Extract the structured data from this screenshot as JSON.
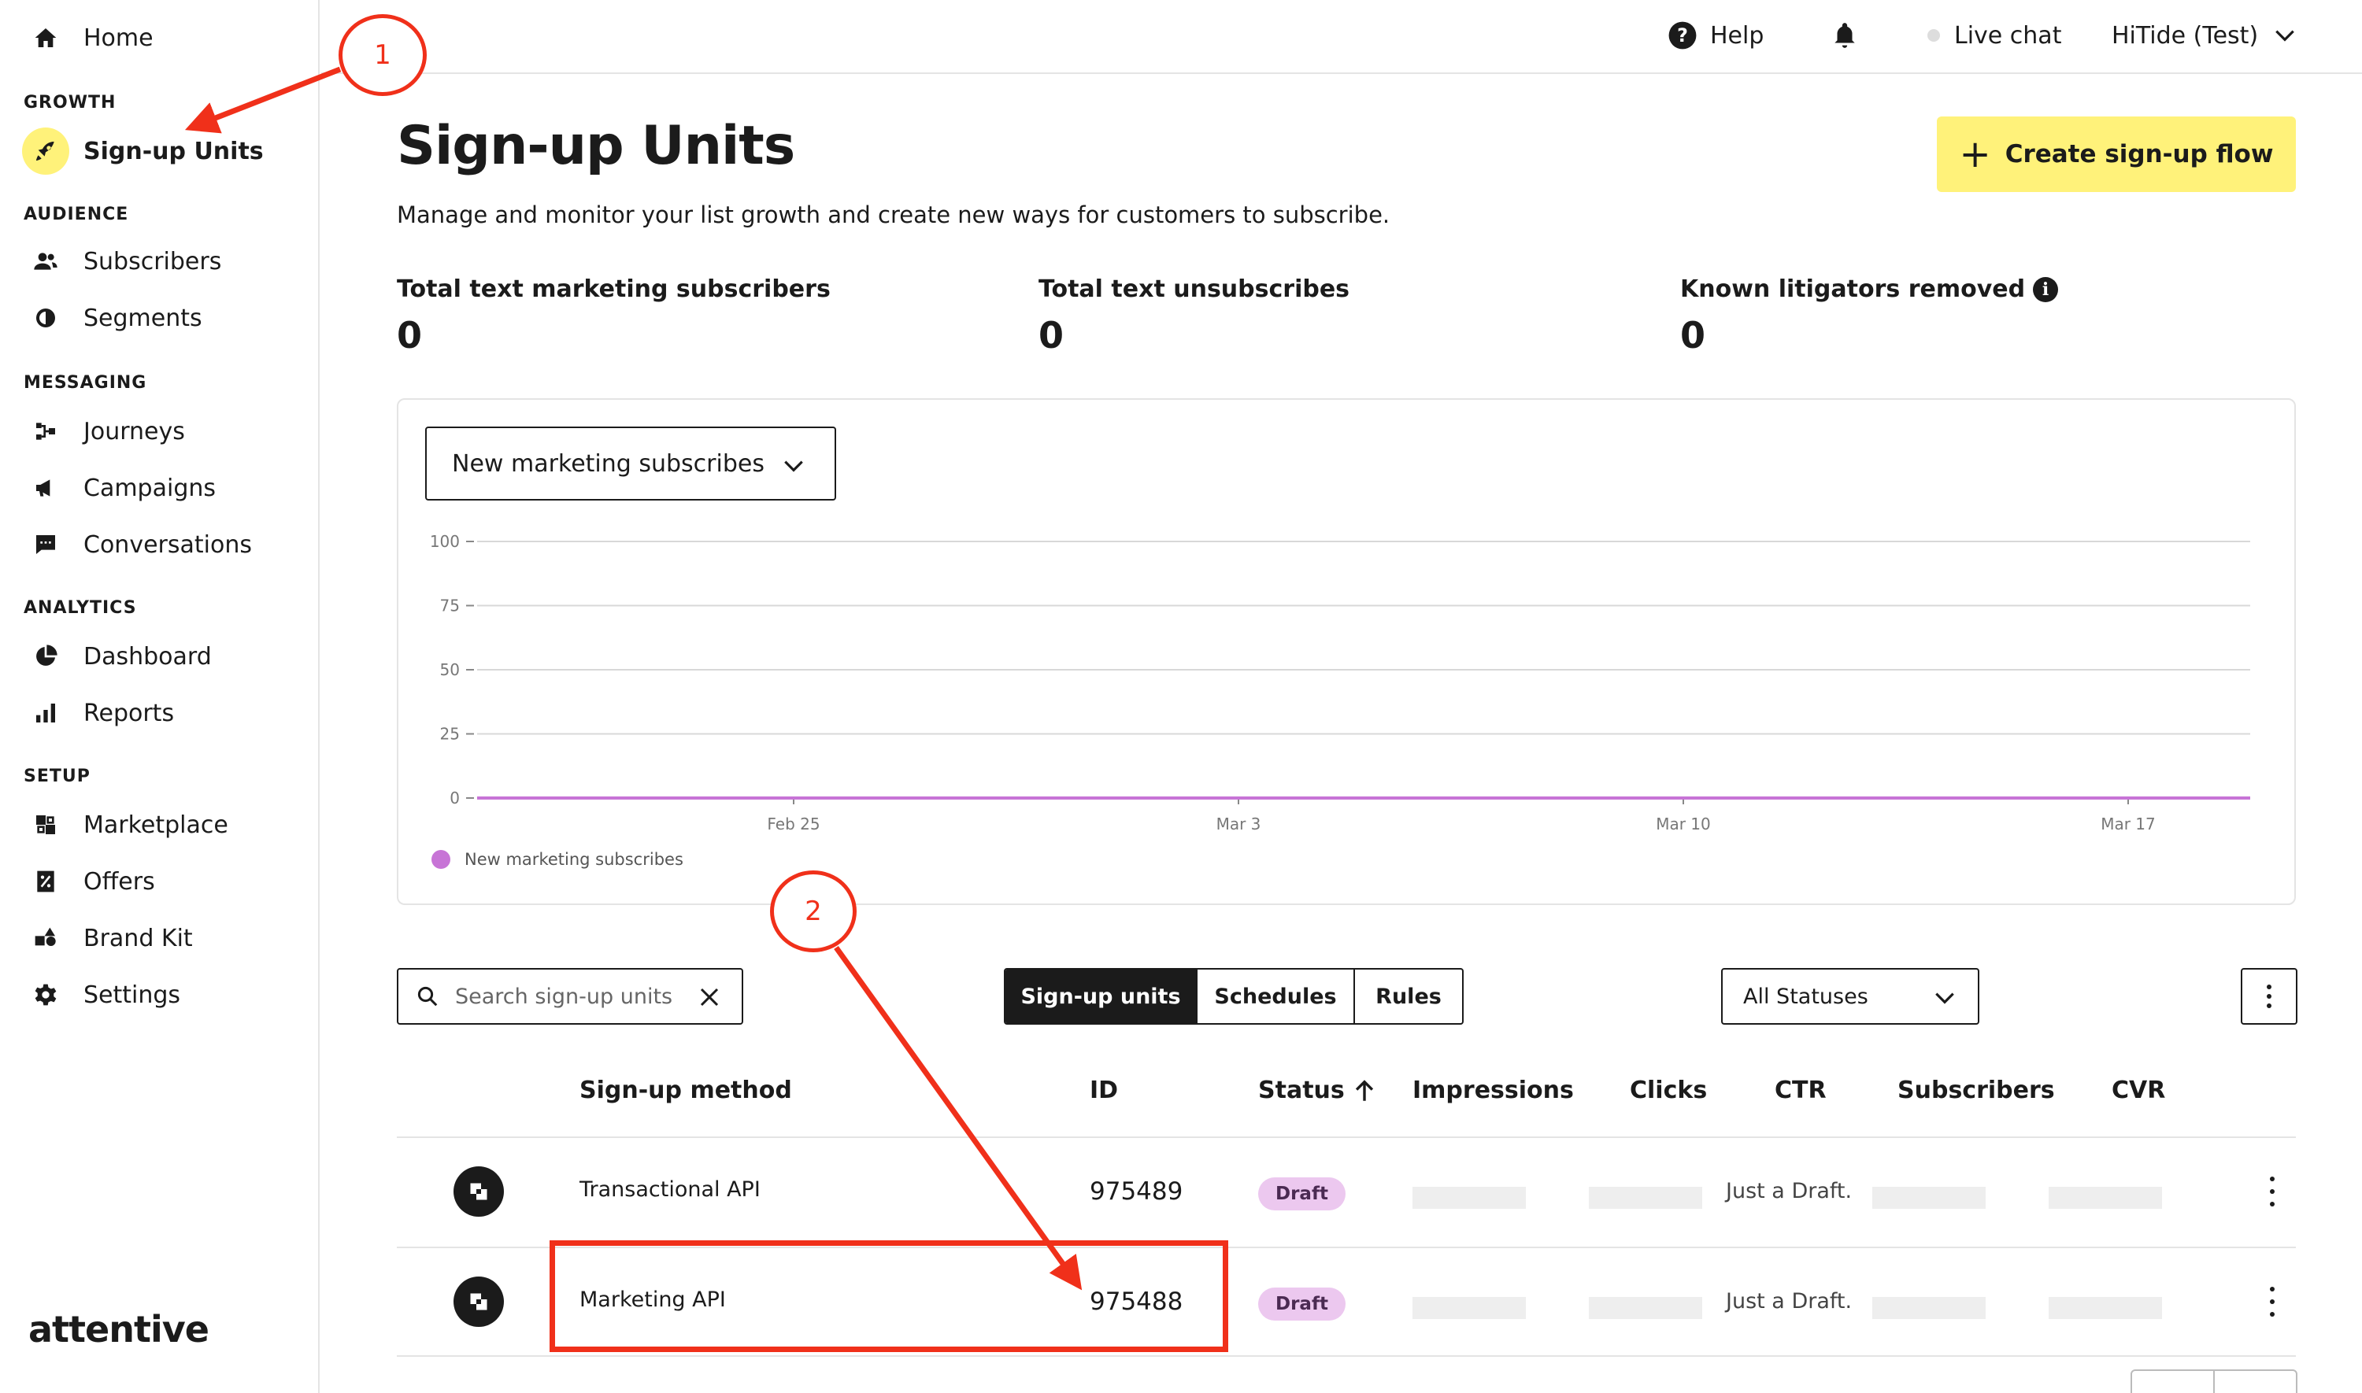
{
  "sidebar": {
    "home": "Home",
    "sections": {
      "growth": "GROWTH",
      "audience": "AUDIENCE",
      "messaging": "MESSAGING",
      "analytics": "ANALYTICS",
      "setup": "SETUP"
    },
    "items": {
      "signup_units": "Sign-up Units",
      "subscribers": "Subscribers",
      "segments": "Segments",
      "journeys": "Journeys",
      "campaigns": "Campaigns",
      "conversations": "Conversations",
      "dashboard": "Dashboard",
      "reports": "Reports",
      "marketplace": "Marketplace",
      "offers": "Offers",
      "brand_kit": "Brand Kit",
      "settings": "Settings"
    },
    "logo": "attentive"
  },
  "topbar": {
    "help": "Help",
    "live_chat": "Live chat",
    "account": "HiTide (Test)"
  },
  "page": {
    "title": "Sign-up Units",
    "description": "Manage and monitor your list growth and create new ways for customers to subscribe.",
    "create_button": "Create sign-up flow"
  },
  "stats": {
    "total_subscribers_label": "Total text marketing subscribers",
    "total_subscribers_value": "0",
    "unsubscribes_label": "Total text unsubscribes",
    "unsubscribes_value": "0",
    "litigators_label": "Known litigators removed",
    "litigators_value": "0"
  },
  "chart_controls": {
    "metric_select": "New marketing subscribes",
    "legend": "New marketing subscribes"
  },
  "chart_data": {
    "type": "line",
    "title": "",
    "xlabel": "",
    "ylabel": "",
    "ylim": [
      0,
      100
    ],
    "yticks": [
      "0",
      "25",
      "50",
      "75",
      "100"
    ],
    "xticks": [
      "Feb 25",
      "Mar 3",
      "Mar 10",
      "Mar 17"
    ],
    "series": [
      {
        "name": "New marketing subscribes",
        "color": "#c774d6",
        "values": [
          0,
          0,
          0,
          0
        ]
      }
    ],
    "grid": true,
    "legend_position": "bottom-left"
  },
  "table_controls": {
    "search_placeholder": "Search sign-up units",
    "tabs": [
      "Sign-up units",
      "Schedules",
      "Rules"
    ],
    "status_filter": "All Statuses"
  },
  "table": {
    "headers": {
      "method": "Sign-up method",
      "id": "ID",
      "status": "Status",
      "impressions": "Impressions",
      "clicks": "Clicks",
      "ctr": "CTR",
      "subscribers": "Subscribers",
      "cvr": "CVR"
    },
    "rows": [
      {
        "method": "Transactional API",
        "id": "975489",
        "status": "Draft",
        "ctr": "Just a Draft."
      },
      {
        "method": "Marketing API",
        "id": "975488",
        "status": "Draft",
        "ctr": "Just a Draft."
      }
    ]
  },
  "annotations": {
    "step1": "1",
    "step2": "2",
    "color": "#f0301a"
  }
}
